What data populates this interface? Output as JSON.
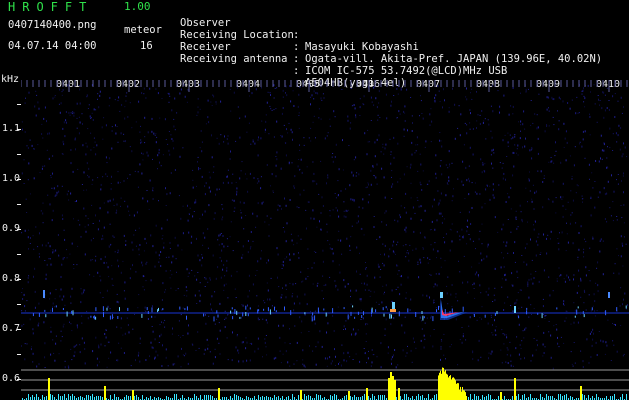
{
  "header": {
    "logo": "HROFFT",
    "version": "1.00",
    "filename": "0407140400.png",
    "meteor_label": "meteor",
    "timestamp": "04.07.14 04:00",
    "meteor_count": "16"
  },
  "info": [
    {
      "key": "Observer",
      "value": "Masayuki Kobayashi"
    },
    {
      "key": "Receiving Location",
      "value": "Ogata-vill. Akita-Pref. JAPAN (139.96E, 40.02N)"
    },
    {
      "key": "Receiver",
      "value": "ICOM IC-575 53.7492(@LCD)MHz USB"
    },
    {
      "key": "Receiving antenna",
      "value": "A504HB(yagi 4el)"
    }
  ],
  "info_colon": ":",
  "axis": {
    "unit": "kHz",
    "y_ticks": [
      "1.1",
      "1.0",
      "0.9",
      "0.8",
      "0.7",
      "0.6"
    ],
    "x_ticks": [
      "0401",
      "0402",
      "0403",
      "0404",
      "0405",
      "0406",
      "0407",
      "0408",
      "0409",
      "0410"
    ]
  },
  "colors": {
    "background": "#000000",
    "header_green": "#2fe04a",
    "text": "#f0f0f0",
    "noise": "#1a1a6e",
    "signal_line": "#3a6cff",
    "meteor_head": "#ff3a6a",
    "histogram_yellow": "#ffff00",
    "histogram_cyan": "#37e6ff",
    "guide_lines": "#9a9a9a"
  }
}
